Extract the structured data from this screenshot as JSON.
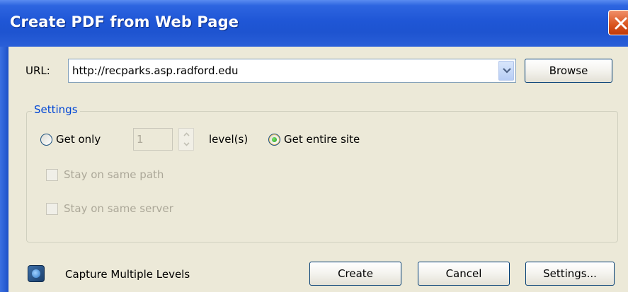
{
  "window": {
    "title": "Create PDF from Web Page"
  },
  "url": {
    "label": "URL:",
    "value": "http://recparks.asp.radford.edu",
    "browse_label": "Browse"
  },
  "settings_group": {
    "title": "Settings",
    "get_only_label": "Get only",
    "levels_value": "1",
    "levels_suffix": "level(s)",
    "get_entire_site_label": "Get entire site",
    "selected_option": "get_entire_site",
    "stay_same_path_label": "Stay on same path",
    "stay_same_server_label": "Stay on same server"
  },
  "footer": {
    "capture_label": "Capture Multiple Levels",
    "create_label": "Create",
    "cancel_label": "Cancel",
    "settings_label": "Settings..."
  },
  "colors": {
    "titlebar": "#1f56d6",
    "dialog_bg": "#ece9d8",
    "group_title": "#0046d5",
    "disabled_text": "#aca899"
  }
}
